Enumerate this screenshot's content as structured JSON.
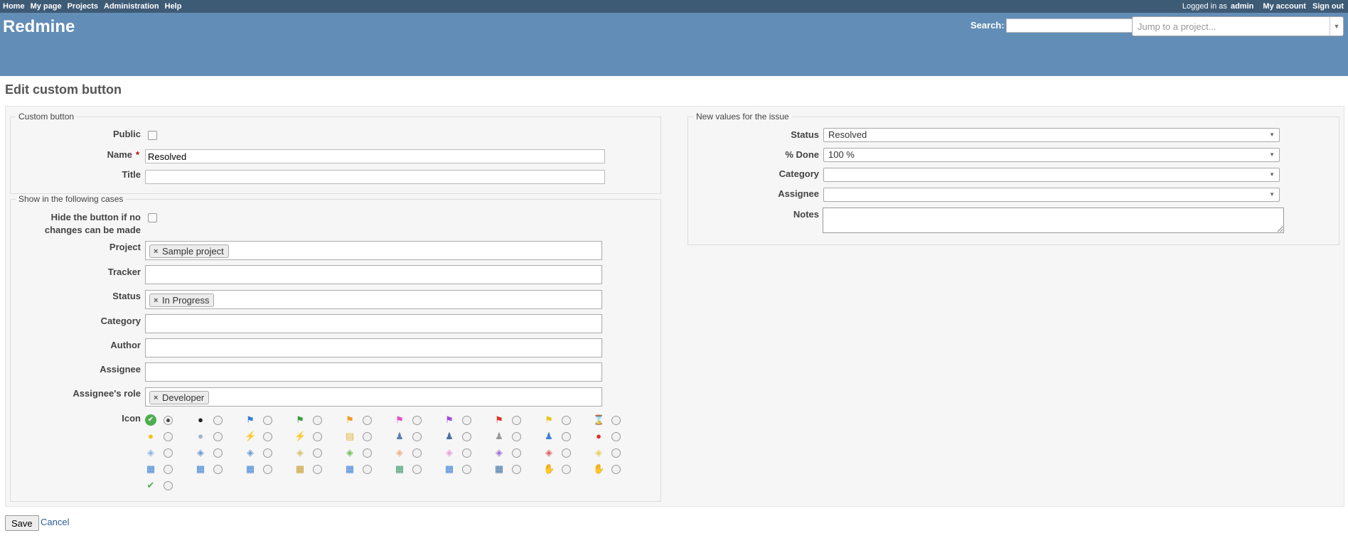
{
  "top_menu": {
    "items": [
      "Home",
      "My page",
      "Projects",
      "Administration",
      "Help"
    ],
    "logged_in_prefix": "Logged in as",
    "user": "admin",
    "my_account": "My account",
    "sign_out": "Sign out"
  },
  "header": {
    "app_title": "Redmine",
    "search_label": "Search:",
    "search_value": "",
    "jump_placeholder": "Jump to a project..."
  },
  "page_title": "Edit custom button",
  "custom_button": {
    "legend": "Custom button",
    "public_label": "Public",
    "public_checked": false,
    "name_label": "Name",
    "name_required_mark": "*",
    "name_value": "Resolved",
    "title_label": "Title",
    "title_value": ""
  },
  "conditions": {
    "legend": "Show in the following cases",
    "hide_label_line1": "Hide the button if no",
    "hide_label_line2": "changes can be made",
    "hide_checked": false,
    "project_label": "Project",
    "project_tags": [
      "Sample project"
    ],
    "tracker_label": "Tracker",
    "status_label": "Status",
    "status_tags": [
      "In Progress"
    ],
    "category_label": "Category",
    "author_label": "Author",
    "assignee_label": "Assignee",
    "assignee_role_label": "Assignee's role",
    "assignee_role_tags": [
      "Developer"
    ],
    "icon_label": "Icon",
    "selected_icon_index": 0,
    "icons": [
      "check-circle-icon",
      "bomb-icon",
      "flag-blue-icon",
      "flag-green-icon",
      "flag-orange-icon",
      "flag-pink-icon",
      "flag-purple-icon",
      "flag-red-icon",
      "flag-yellow-icon",
      "hourglass-icon",
      "bulb-on-icon",
      "bulb-off-icon",
      "lightning-add-icon",
      "lightning-delete-icon",
      "note-add-icon",
      "user-info-icon",
      "user-delete-icon",
      "user-gray-icon",
      "user-blue-icon",
      "red-ball-icon",
      "tag-blue-icon",
      "tag-blue-add-icon",
      "tag-blue-delete-icon",
      "tag-edit-icon",
      "tag-green-icon",
      "tag-orange-icon",
      "tag-pink-icon",
      "tag-purple-icon",
      "tag-red-icon",
      "tag-yellow-icon",
      "calendar-icon",
      "calendar-add-icon",
      "calendar-delete-icon",
      "calendar-edit-icon",
      "calendar-warning-icon",
      "calendar-go-icon",
      "calendar-link-icon",
      "calendar-view-icon",
      "thumb-down-icon",
      "thumb-up-icon",
      "check-mark-icon"
    ]
  },
  "new_values": {
    "legend": "New values for the issue",
    "status_label": "Status",
    "status_value": "Resolved",
    "done_label": "% Done",
    "done_value": "100 %",
    "category_label": "Category",
    "category_value": "",
    "assignee_label": "Assignee",
    "assignee_value": "",
    "notes_label": "Notes",
    "notes_value": ""
  },
  "actions": {
    "save": "Save",
    "cancel": "Cancel"
  }
}
